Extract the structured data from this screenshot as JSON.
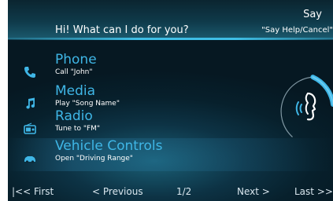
{
  "header": {
    "prompt": "Hi! What can I do for you?",
    "say_title": "Say",
    "say_hint": "\"Say Help/Cancel\""
  },
  "menu": [
    {
      "title": "Phone",
      "subtitle": "Call \"John\"",
      "icon": "phone-icon"
    },
    {
      "title": "Media",
      "subtitle": "Play \"Song Name\"",
      "icon": "music-note-icon"
    },
    {
      "title": "Radio",
      "subtitle": "Tune to \"FM\"",
      "icon": "radio-icon"
    },
    {
      "title": "Vehicle Controls",
      "subtitle": "Open \"Driving Range\"",
      "icon": "car-icon"
    }
  ],
  "footer": {
    "first": "|<< First",
    "previous": "< Previous",
    "page": "1/2",
    "next": "Next >",
    "last": "Last >>"
  },
  "voice": {
    "icon": "speaking-head-icon"
  },
  "colors": {
    "accent": "#3fb6e6",
    "text": "#ffffff",
    "background": "#07202c"
  }
}
